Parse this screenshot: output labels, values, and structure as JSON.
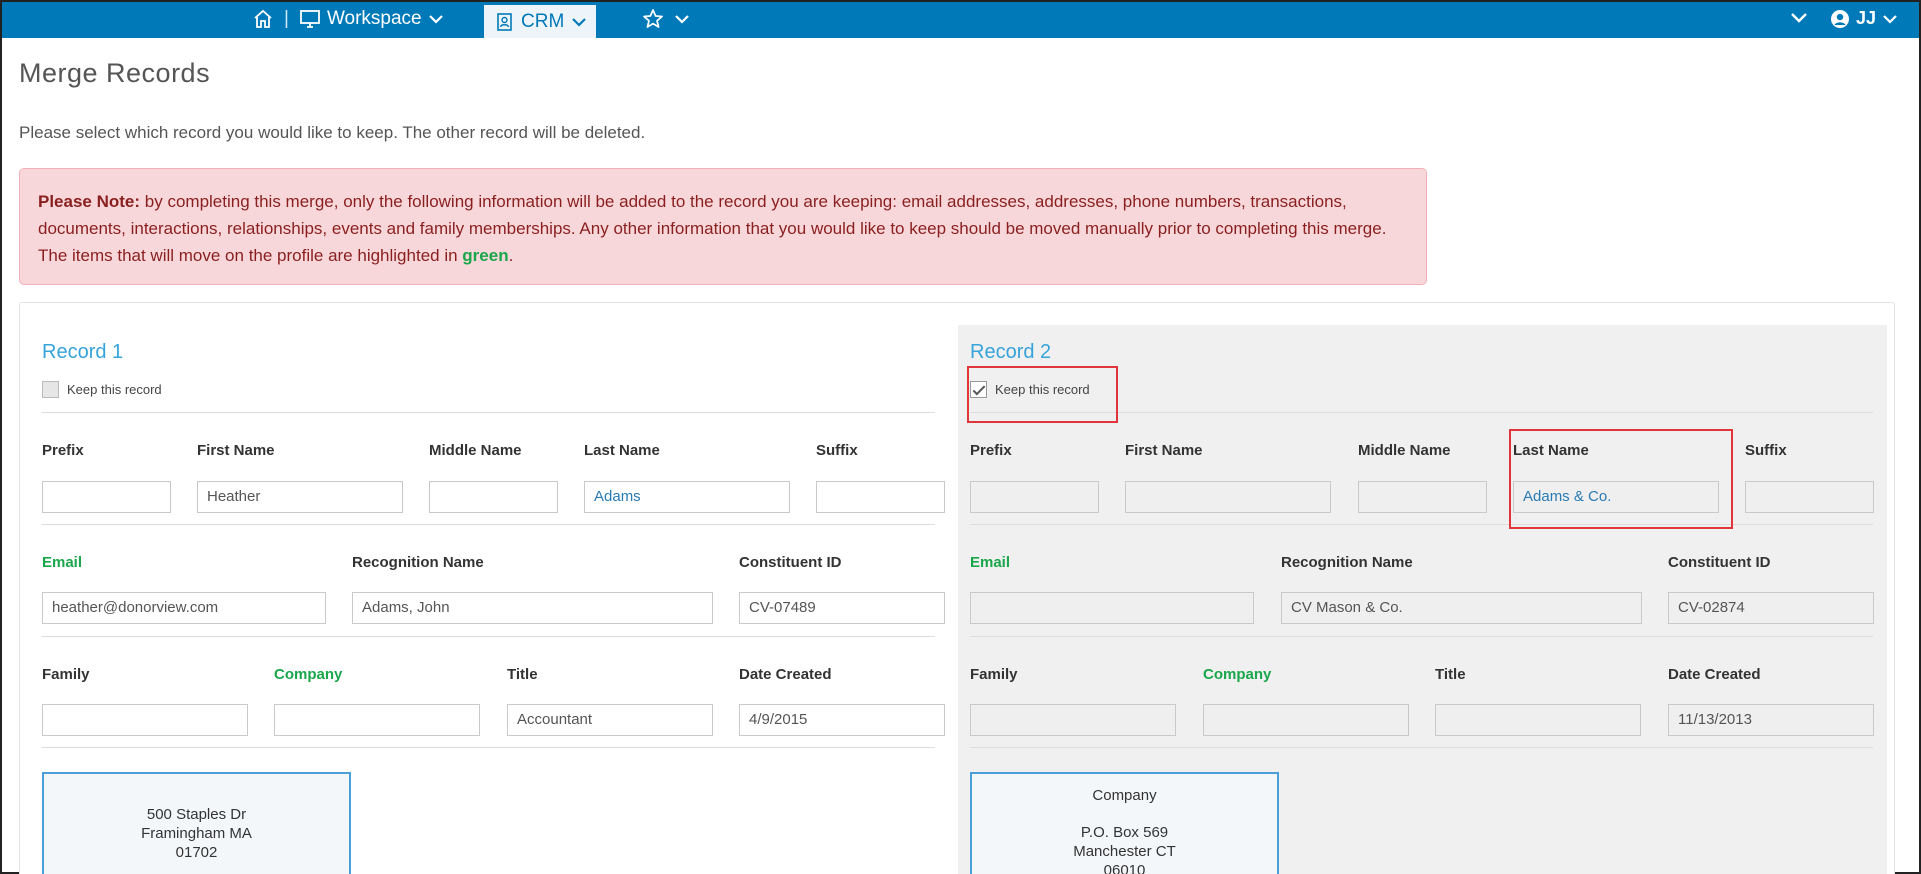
{
  "topbar": {
    "workspace_label": "Workspace",
    "crm_label": "CRM",
    "user_initials": "JJ",
    "colors": {
      "bar": "#0079b8"
    }
  },
  "page": {
    "title": "Merge Records",
    "intro": "Please select which record you would like to keep. The other record will be deleted."
  },
  "alert": {
    "strong": "Please Note:",
    "text": " by completing this merge, only the following information will be added to the record you are keeping: email addresses, addresses, phone numbers, transactions, documents, interactions, relationships, events and family memberships. Any other information that you would like to keep should be moved manually prior to completing this merge. The items that will move on the profile are highlighted in ",
    "green_word": "green",
    "end": "."
  },
  "labels": {
    "keep": "Keep this record",
    "prefix": "Prefix",
    "first_name": "First Name",
    "middle_name": "Middle Name",
    "last_name": "Last Name",
    "suffix": "Suffix",
    "email": "Email",
    "recognition_name": "Recognition Name",
    "constituent_id": "Constituent ID",
    "family": "Family",
    "company": "Company",
    "title": "Title",
    "date_created": "Date Created"
  },
  "record1": {
    "title": "Record 1",
    "keep_checked": false,
    "prefix": "",
    "first_name": "Heather",
    "middle_name": "",
    "last_name": "Adams",
    "suffix": "",
    "email": "heather@donorview.com",
    "recognition_name": "Adams, John",
    "constituent_id": "CV-07489",
    "family": "",
    "company": "",
    "title_value": "Accountant",
    "date_created": "4/9/2015",
    "address": {
      "line1": "500 Staples Dr",
      "line2": "Framingham MA",
      "line3": "01702"
    }
  },
  "record2": {
    "title": "Record 2",
    "keep_checked": true,
    "prefix": "",
    "first_name": "",
    "middle_name": "",
    "last_name": "Adams & Co.",
    "suffix": "",
    "email": "",
    "recognition_name": "CV Mason & Co.",
    "constituent_id": "CV-02874",
    "family": "",
    "company": "",
    "title_value": "",
    "date_created": "11/13/2013",
    "address": {
      "type": "Company",
      "line1": "P.O. Box 569",
      "line2": "Manchester CT",
      "line3": "06010"
    }
  }
}
